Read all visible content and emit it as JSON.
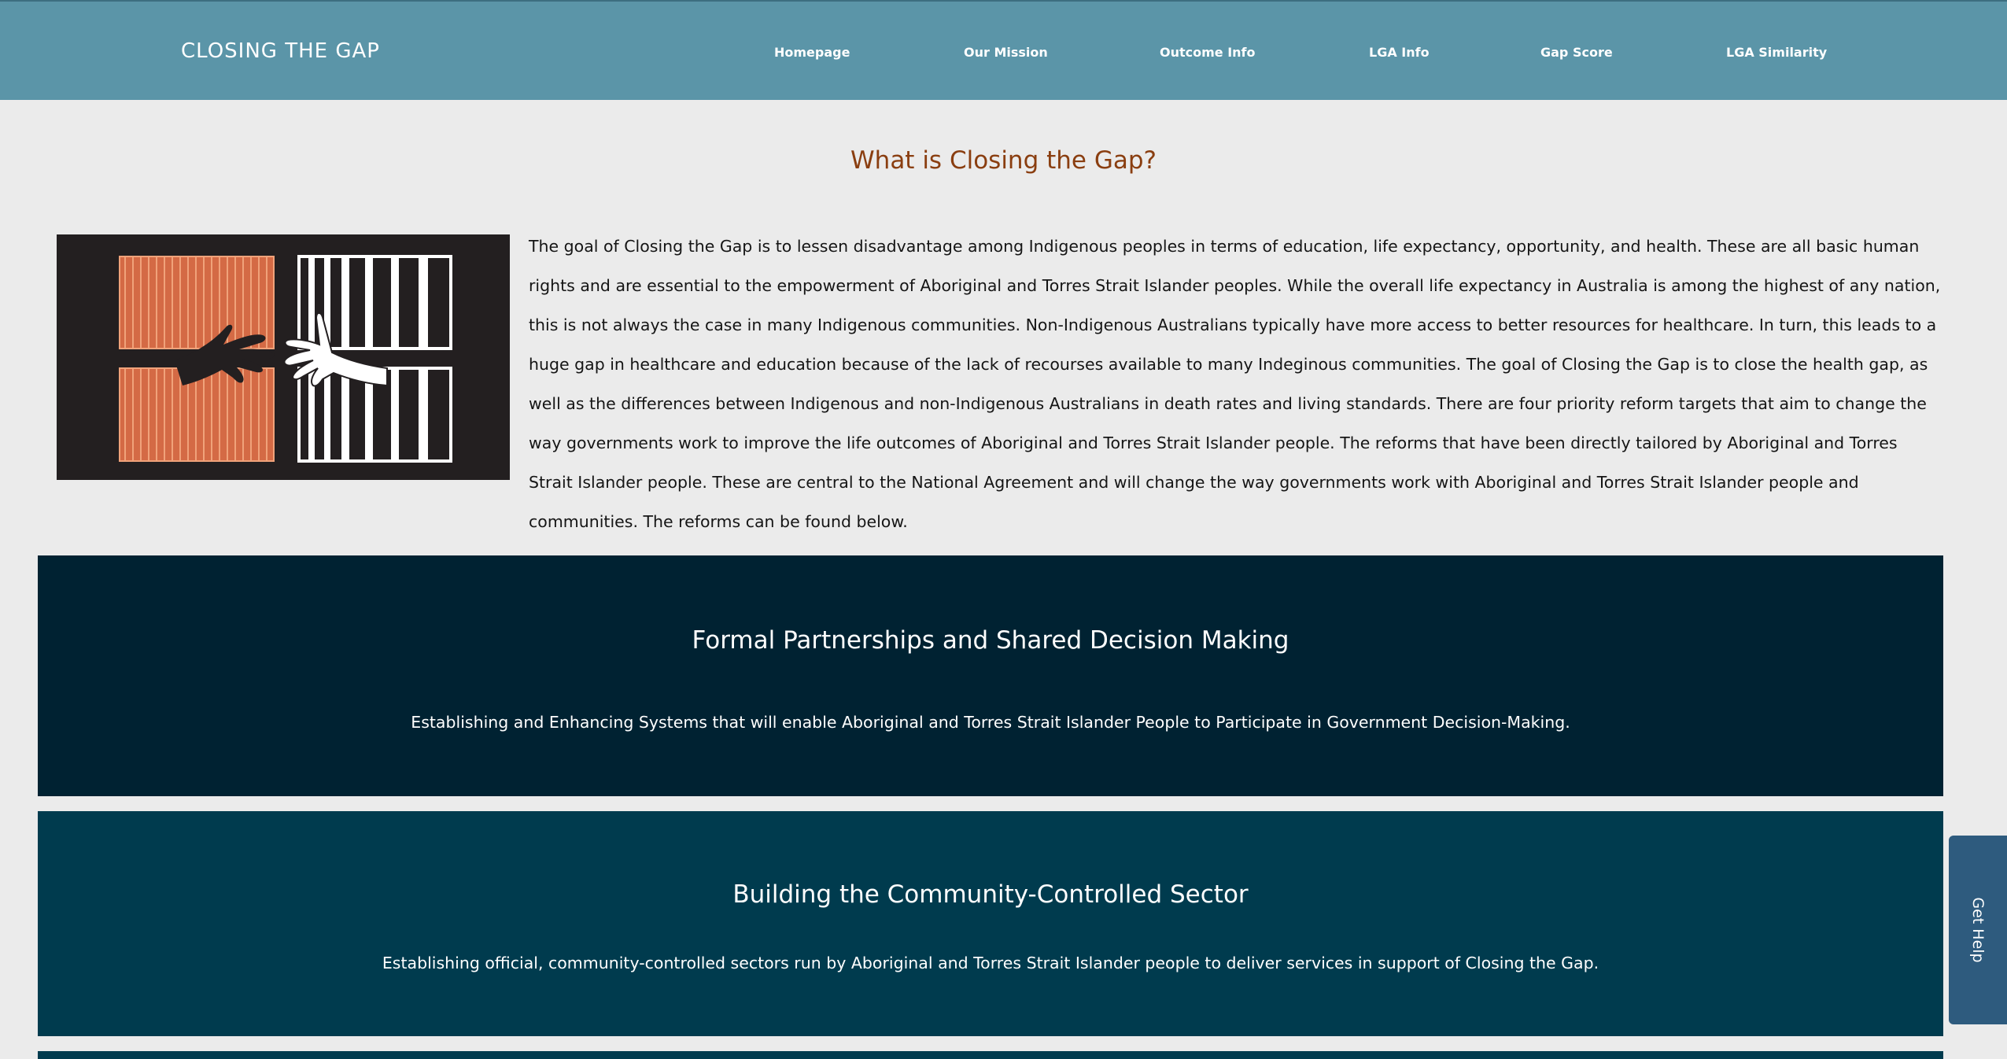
{
  "header": {
    "brand": "CLOSING THE GAP",
    "nav": [
      {
        "label": "Homepage"
      },
      {
        "label": "Our Mission"
      },
      {
        "label": "Outcome Info"
      },
      {
        "label": "LGA Info"
      },
      {
        "label": "Gap Score"
      },
      {
        "label": "LGA Similarity"
      }
    ]
  },
  "main": {
    "title": "What is Closing the Gap?",
    "intro": "The goal of Closing the Gap is to lessen disadvantage among Indigenous peoples in terms of education, life expectancy, opportunity, and health. These are all basic human rights and are essential to the empowerment of Aboriginal and Torres Strait Islander peoples. While the overall life expectancy in Australia is among the highest of any nation, this is not always the case in many Indigenous communities. Non-Indigenous Australians typically have more access to better resources for healthcare. In turn, this leads to a huge gap in healthcare and education because of the lack of recourses available to many Indeginous communities. The goal of Closing the Gap is to close the health gap, as well as the differences between Indigenous and non-Indigenous Australians in death rates and living standards. There are four priority reform targets that aim to change the way governments work to improve the life outcomes of Aboriginal and Torres Strait Islander people. The reforms that have been directly tailored by Aboriginal and Torres Strait Islander people. These are central to the National Agreement and will change the way governments work with Aboriginal and Torres Strait Islander people and communities. The reforms can be found below.",
    "reforms": [
      {
        "title": "Formal Partnerships and Shared Decision Making",
        "description": "Establishing and Enhancing Systems that will enable Aboriginal and Torres Strait Islander People to Participate in Government Decision-Making."
      },
      {
        "title": "Building the Community-Controlled Sector",
        "description": "Establishing official, community-controlled sectors run by Aboriginal and Torres Strait Islander people to deliver services in support of Closing the Gap."
      }
    ]
  },
  "help_tab": {
    "label": "Get Help"
  },
  "colors": {
    "header_bg": "#5b95a8",
    "page_bg": "#ebebeb",
    "title": "#8a3e10",
    "panel_dark": "#002232",
    "panel_teal": "#003b4e",
    "help_tab": "#2e5b7e",
    "art_orange": "#d46a45"
  }
}
